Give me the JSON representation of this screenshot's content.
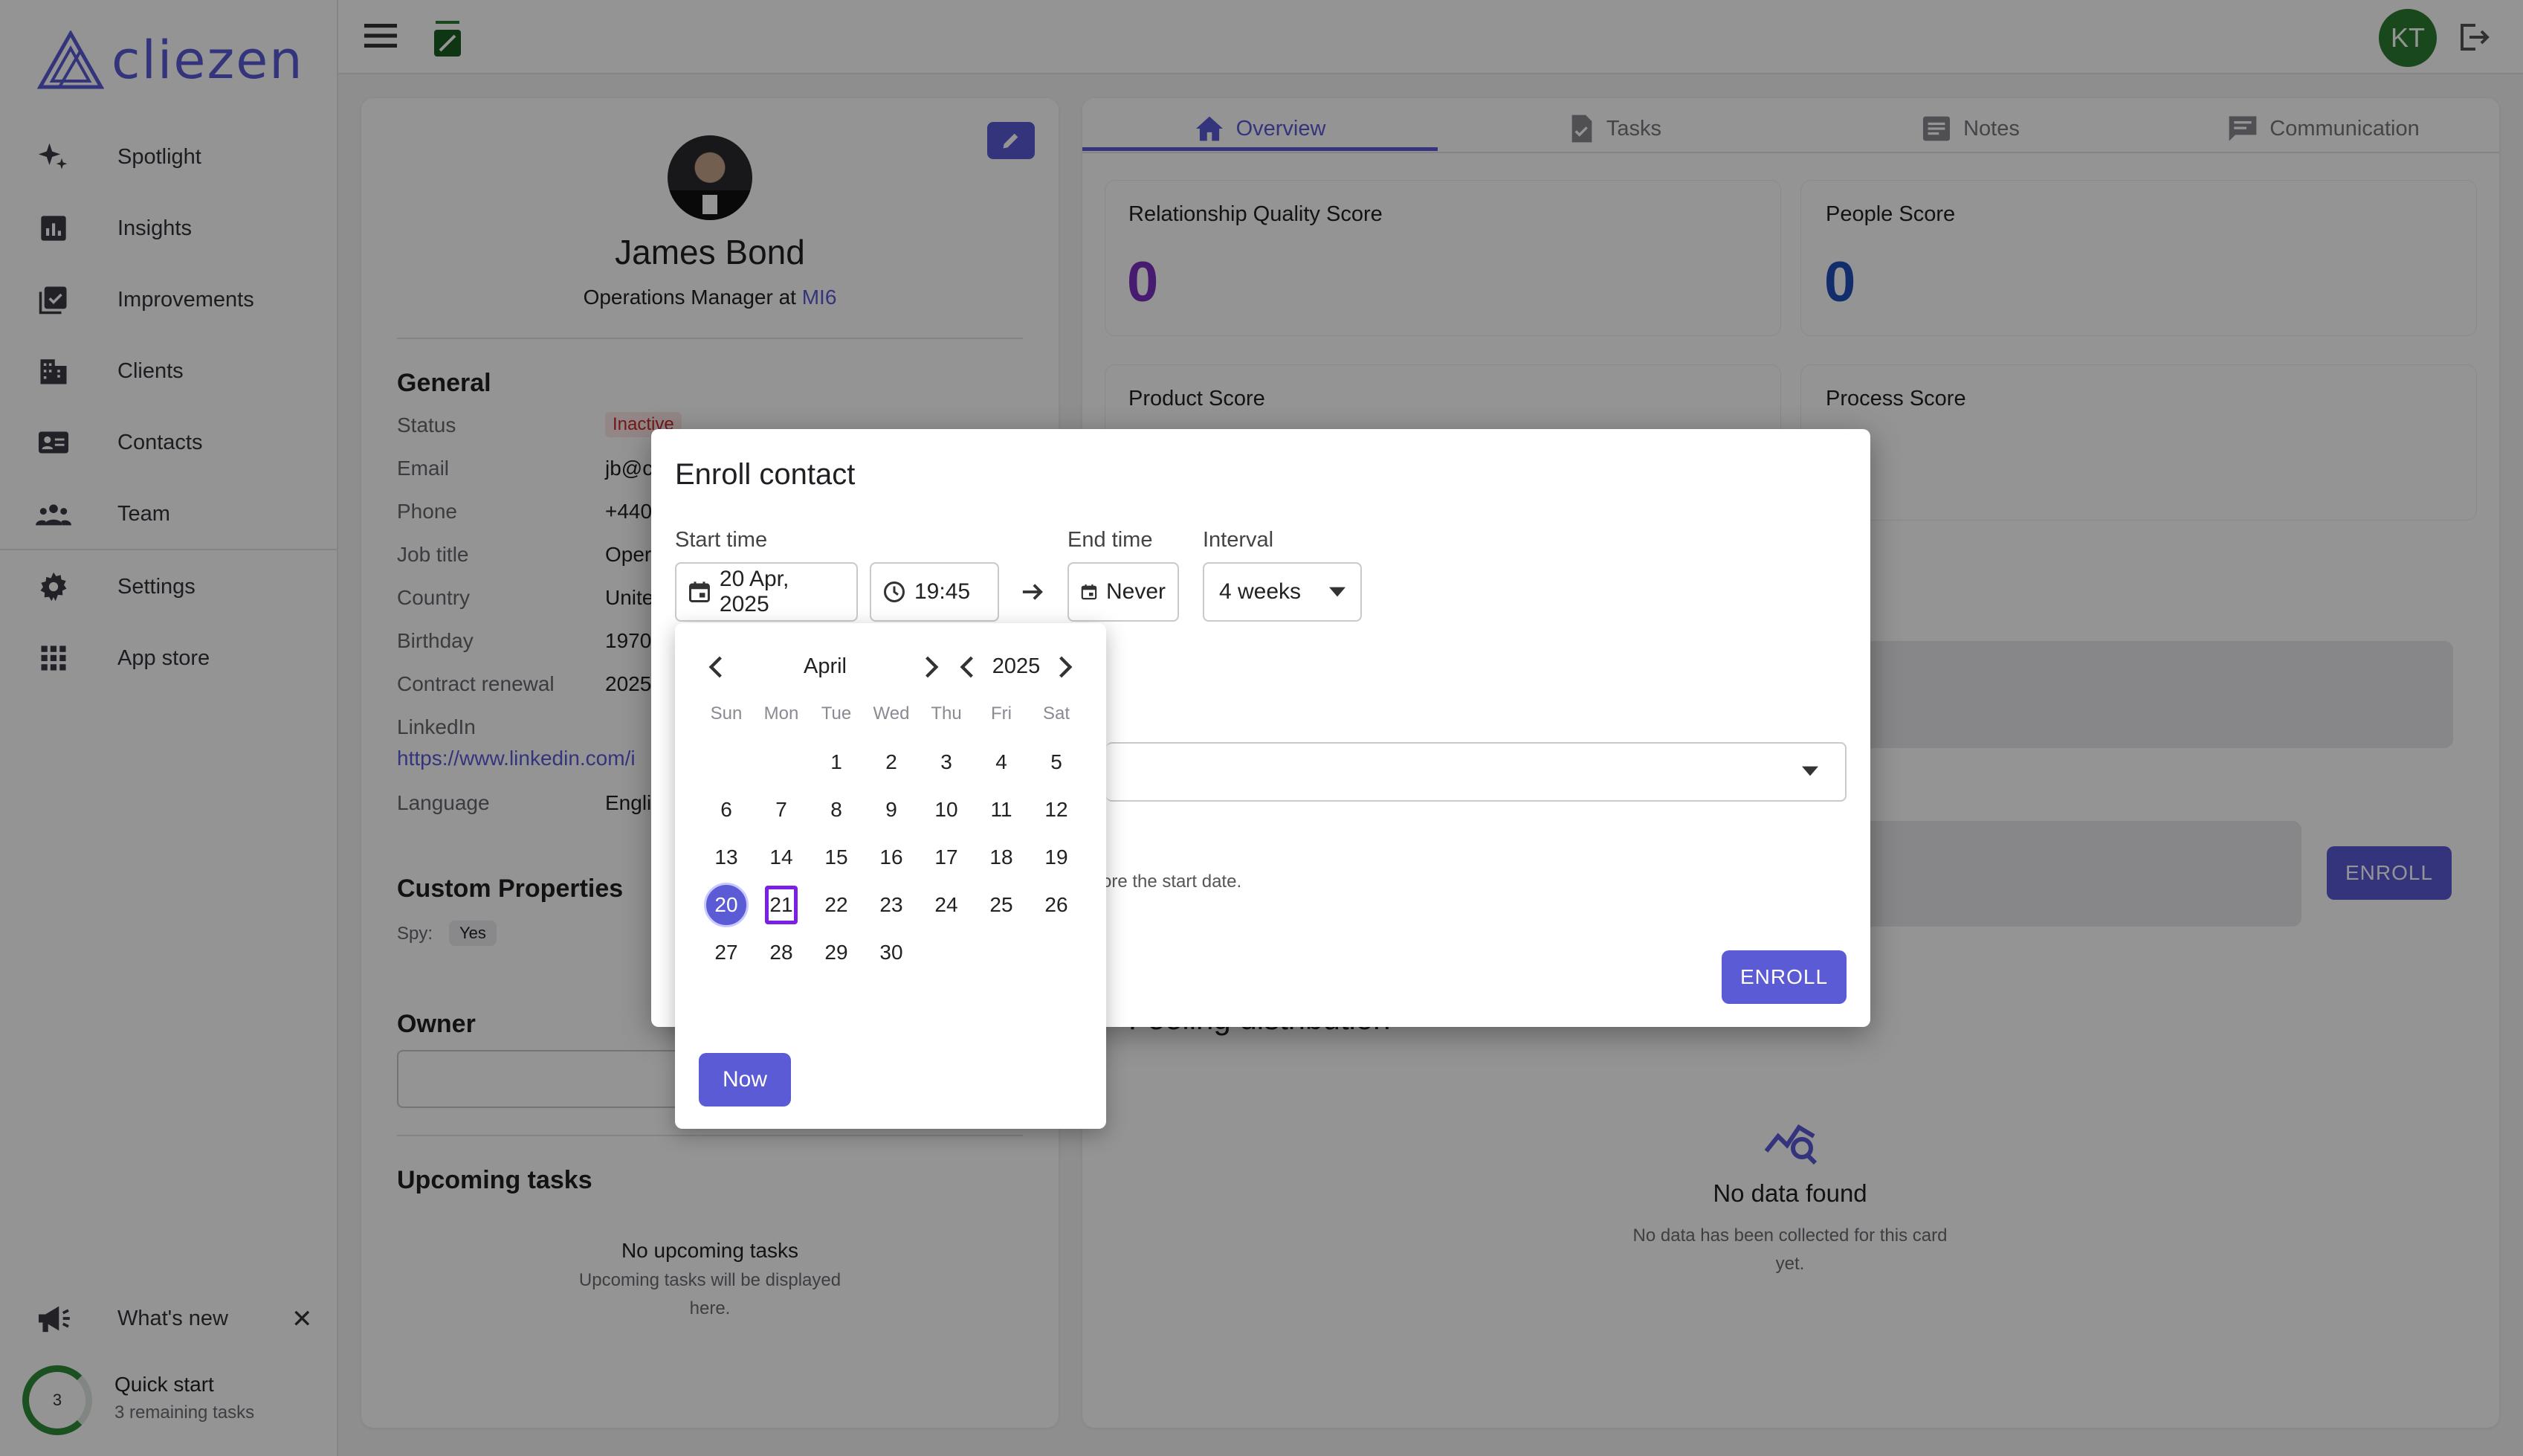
{
  "app": {
    "logo_text": "cliezen",
    "user_initials": "KT"
  },
  "sidebar": {
    "items": [
      {
        "label": "Spotlight",
        "icon": "sparkles-icon"
      },
      {
        "label": "Insights",
        "icon": "chart-icon"
      },
      {
        "label": "Improvements",
        "icon": "checklist-icon"
      },
      {
        "label": "Clients",
        "icon": "building-icon"
      },
      {
        "label": "Contacts",
        "icon": "contact-card-icon"
      },
      {
        "label": "Team",
        "icon": "people-icon"
      },
      {
        "label": "Settings",
        "icon": "gear-icon"
      },
      {
        "label": "App store",
        "icon": "grid-icon"
      }
    ],
    "whats_new": "What's new",
    "quick_start": {
      "title": "Quick start",
      "subtitle": "3 remaining tasks",
      "count": "3"
    }
  },
  "profile": {
    "name": "James Bond",
    "role_prefix": "Operations Manager at",
    "company": "MI6",
    "general_title": "General",
    "rows": [
      {
        "label": "Status",
        "value": "Inactive"
      },
      {
        "label": "Email",
        "value": "jb@c"
      },
      {
        "label": "Phone",
        "value": "+440"
      },
      {
        "label": "Job title",
        "value": "Oper"
      },
      {
        "label": "Country",
        "value": "Unite"
      },
      {
        "label": "Birthday",
        "value": "1970,"
      },
      {
        "label": "Contract renewal",
        "value": "2025"
      }
    ],
    "linkedin_label": "LinkedIn",
    "linkedin_value": "https://www.linkedin.com/i",
    "language_label": "Language",
    "language_value": "Engli",
    "custom_title": "Custom Properties",
    "custom_key": "Spy:",
    "custom_val": "Yes",
    "owner_title": "Owner",
    "upcoming_title": "Upcoming tasks",
    "upcoming_empty": "No upcoming tasks",
    "upcoming_hint_1": "Upcoming tasks will be displayed",
    "upcoming_hint_2": "here."
  },
  "tabs": [
    {
      "label": "Overview",
      "icon": "home-icon"
    },
    {
      "label": "Tasks",
      "icon": "task-icon"
    },
    {
      "label": "Notes",
      "icon": "notes-icon"
    },
    {
      "label": "Communication",
      "icon": "chat-icon"
    }
  ],
  "scores": {
    "rq_label": "Relationship Quality Score",
    "rq_value": "0",
    "people_label": "People Score",
    "people_value": "0",
    "product_label": "Product Score",
    "process_label": "Process Score"
  },
  "background": {
    "enroll_label": "ENROLL",
    "feeling_title": "Feeling distribution",
    "no_data_title": "No data found",
    "no_data_line1": "No data has been collected for this card",
    "no_data_line2": "yet."
  },
  "dialog": {
    "title": "Enroll contact",
    "start_label": "Start time",
    "start_date": "20 Apr, 2025",
    "start_time": "19:45",
    "end_label": "End time",
    "end_value": "Never",
    "interval_label": "Interval",
    "interval_value": "4 weeks",
    "hint": "ore the start date.",
    "enroll_label": "ENROLL"
  },
  "calendar": {
    "month": "April",
    "year": "2025",
    "weekdays": [
      "Sun",
      "Mon",
      "Tue",
      "Wed",
      "Thu",
      "Fri",
      "Sat"
    ],
    "selected_day": "20",
    "focused_day": "21",
    "now_label": "Now"
  },
  "colors": {
    "accent": "#5b5bd6",
    "rq_score": "#7b2fbf",
    "people_score": "#1e4fb8",
    "status_inactive": "#c62828"
  }
}
